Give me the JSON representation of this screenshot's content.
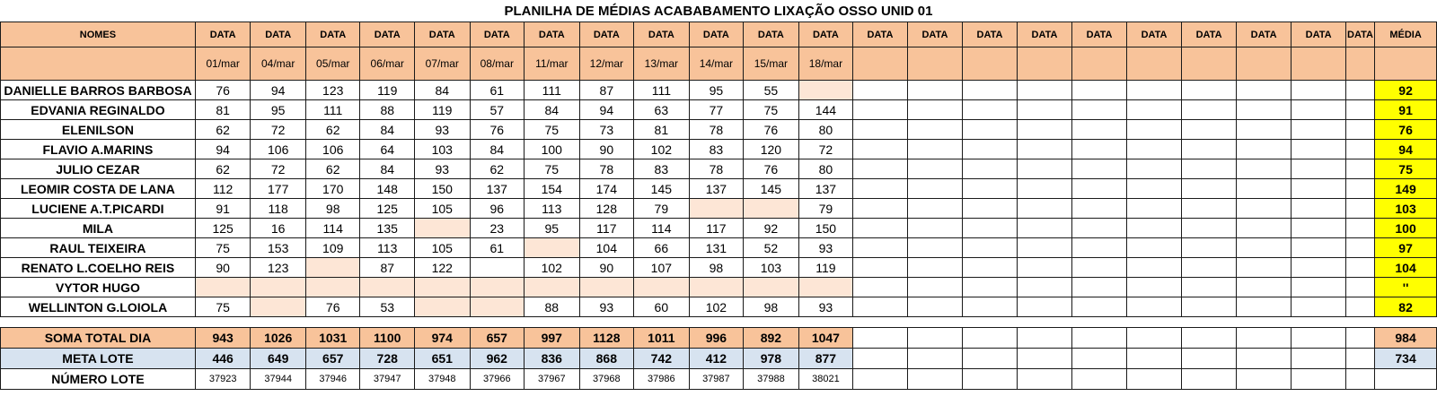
{
  "title": "PLANILHA DE MÉDIAS ACABABAMENTO LIXAÇÃO OSSO UNID 01",
  "header": {
    "names_label": "NOMES",
    "data_label": "DATA",
    "media_label": "MÉDIA",
    "dates": [
      "01/mar",
      "04/mar",
      "05/mar",
      "06/mar",
      "07/mar",
      "08/mar",
      "11/mar",
      "12/mar",
      "13/mar",
      "14/mar",
      "15/mar",
      "18/mar"
    ]
  },
  "rows": [
    {
      "name": "DANIELLE BARROS BARBOSA",
      "values": [
        "76",
        "94",
        "123",
        "119",
        "84",
        "61",
        "111",
        "87",
        "111",
        "95",
        "55",
        ""
      ],
      "missing": [
        11
      ],
      "media": "92"
    },
    {
      "name": "EDVANIA REGINALDO",
      "values": [
        "81",
        "95",
        "111",
        "88",
        "119",
        "57",
        "84",
        "94",
        "63",
        "77",
        "75",
        "144"
      ],
      "missing": [],
      "media": "91"
    },
    {
      "name": "ELENILSON",
      "values": [
        "62",
        "72",
        "62",
        "84",
        "93",
        "76",
        "75",
        "73",
        "81",
        "78",
        "76",
        "80"
      ],
      "missing": [],
      "media": "76"
    },
    {
      "name": "FLAVIO A.MARINS",
      "values": [
        "94",
        "106",
        "106",
        "64",
        "103",
        "84",
        "100",
        "90",
        "102",
        "83",
        "120",
        "72"
      ],
      "missing": [],
      "media": "94"
    },
    {
      "name": "JULIO CEZAR",
      "values": [
        "62",
        "72",
        "62",
        "84",
        "93",
        "62",
        "75",
        "78",
        "83",
        "78",
        "76",
        "80"
      ],
      "missing": [],
      "media": "75"
    },
    {
      "name": "LEOMIR COSTA DE LANA",
      "values": [
        "112",
        "177",
        "170",
        "148",
        "150",
        "137",
        "154",
        "174",
        "145",
        "137",
        "145",
        "137"
      ],
      "missing": [],
      "media": "149"
    },
    {
      "name": "LUCIENE A.T.PICARDI",
      "values": [
        "91",
        "118",
        "98",
        "125",
        "105",
        "96",
        "113",
        "128",
        "79",
        "",
        "",
        "79"
      ],
      "missing": [
        9,
        10
      ],
      "media": "103"
    },
    {
      "name": "MILA",
      "values": [
        "125",
        "16",
        "114",
        "135",
        "",
        "23",
        "95",
        "117",
        "114",
        "117",
        "92",
        "150"
      ],
      "missing": [
        4
      ],
      "media": "100"
    },
    {
      "name": "RAUL TEIXEIRA",
      "values": [
        "75",
        "153",
        "109",
        "113",
        "105",
        "61",
        "",
        "104",
        "66",
        "131",
        "52",
        "93"
      ],
      "missing": [
        6
      ],
      "media": "97"
    },
    {
      "name": "RENATO L.COELHO REIS",
      "values": [
        "90",
        "123",
        "",
        "87",
        "122",
        "",
        "102",
        "90",
        "107",
        "98",
        "103",
        "119"
      ],
      "missing": [
        2
      ],
      "media": "104"
    },
    {
      "name": "VYTOR HUGO",
      "values": [
        "",
        "",
        "",
        "",
        "",
        "",
        "",
        "",
        "",
        "",
        "",
        ""
      ],
      "missing": [
        0,
        1,
        2,
        3,
        4,
        5,
        6,
        7,
        8,
        9,
        10,
        11
      ],
      "media": "''"
    },
    {
      "name": "WELLINTON G.LOIOLA",
      "values": [
        "75",
        "",
        "76",
        "53",
        "",
        "",
        "88",
        "93",
        "60",
        "102",
        "98",
        "93"
      ],
      "missing": [
        1,
        4,
        5
      ],
      "media": "82"
    }
  ],
  "totals": {
    "soma_label": "SOMA TOTAL DIA",
    "soma_values": [
      "943",
      "1026",
      "1031",
      "1100",
      "974",
      "657",
      "997",
      "1128",
      "1011",
      "996",
      "892",
      "1047"
    ],
    "soma_media": "984",
    "meta_label": "META LOTE",
    "meta_values": [
      "446",
      "649",
      "657",
      "728",
      "651",
      "962",
      "836",
      "868",
      "742",
      "412",
      "978",
      "877"
    ],
    "meta_media": "734",
    "lote_label": "NÚMERO LOTE",
    "lote_values": [
      "37923",
      "37944",
      "37946",
      "37947",
      "37948",
      "37966",
      "37967",
      "37968",
      "37986",
      "37987",
      "37988",
      "38021"
    ]
  },
  "colors": {
    "header_bg": "#f8c39a",
    "missing_bg": "#fde6d6",
    "media_bg": "#ffff00",
    "meta_bg": "#d7e3f0"
  }
}
